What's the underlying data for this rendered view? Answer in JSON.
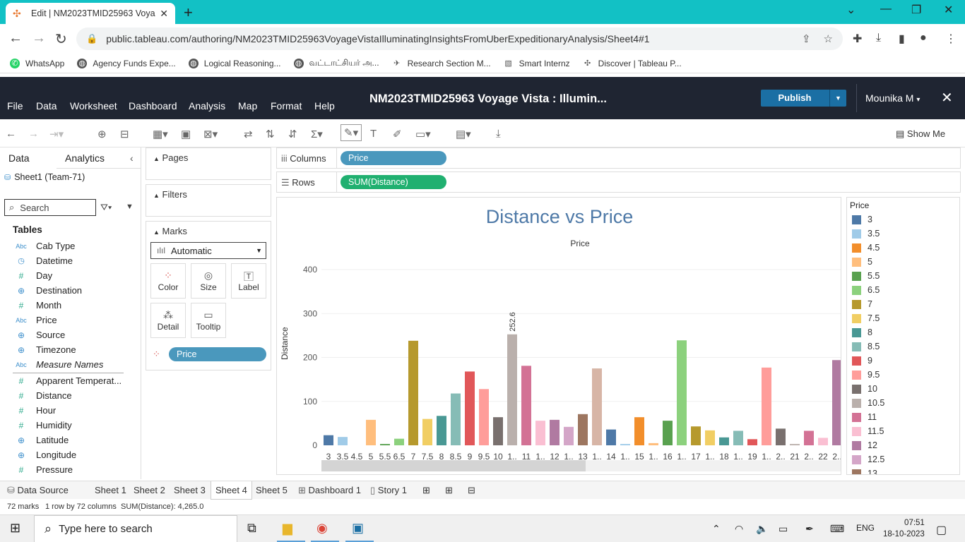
{
  "browser": {
    "tab_title": "Edit | NM2023TMID25963 Voyag",
    "url": "public.tableau.com/authoring/NM2023TMID25963VoyageVistaIlluminatingInsightsFromUberExpeditionaryAnalysis/Sheet4#1",
    "bookmarks": [
      "WhatsApp",
      "Agency Funds Expe...",
      "Logical Reasoning...",
      "வட்டாட்சியர் அ...",
      "Research Section M...",
      "Smart Internz",
      "Discover | Tableau P..."
    ]
  },
  "header": {
    "menus": [
      "File",
      "Data",
      "Worksheet",
      "Dashboard",
      "Analysis",
      "Map",
      "Format",
      "Help"
    ],
    "workbook_title": "NM2023TMID25963 Voyage Vista : Illumin...",
    "publish": "Publish",
    "user": "Mounika M"
  },
  "toolbar": {
    "show_me": "Show Me"
  },
  "data_pane": {
    "tab_data": "Data",
    "tab_analytics": "Analytics",
    "source": "Sheet1 (Team-71)",
    "search_placeholder": "Search",
    "tables_header": "Tables",
    "fields": [
      {
        "name": "Cab Type",
        "type": "abc"
      },
      {
        "name": "Datetime",
        "type": "date"
      },
      {
        "name": "Day",
        "type": "num"
      },
      {
        "name": "Destination",
        "type": "geo"
      },
      {
        "name": "Month",
        "type": "num"
      },
      {
        "name": "Price",
        "type": "abc"
      },
      {
        "name": "Source",
        "type": "geo"
      },
      {
        "name": "Timezone",
        "type": "geo"
      },
      {
        "name": "Measure Names",
        "type": "abc"
      }
    ],
    "measures": [
      {
        "name": "Apparent Temperat...",
        "type": "num"
      },
      {
        "name": "Distance",
        "type": "num"
      },
      {
        "name": "Hour",
        "type": "num"
      },
      {
        "name": "Humidity",
        "type": "num"
      },
      {
        "name": "Latitude",
        "type": "geo"
      },
      {
        "name": "Longitude",
        "type": "geo"
      },
      {
        "name": "Pressure",
        "type": "num"
      }
    ]
  },
  "cards": {
    "pages": "Pages",
    "filters": "Filters",
    "marks": "Marks",
    "mark_type": "Automatic",
    "color": "Color",
    "size": "Size",
    "label": "Label",
    "detail": "Detail",
    "tooltip": "Tooltip",
    "color_pill": "Price"
  },
  "shelves": {
    "columns_label": "Columns",
    "columns_pill": "Price",
    "rows_label": "Rows",
    "rows_pill": "SUM(Distance)"
  },
  "legend": {
    "title": "Price",
    "items": [
      {
        "label": "3",
        "color": "#4e79a7"
      },
      {
        "label": "3.5",
        "color": "#a0cbe8"
      },
      {
        "label": "4.5",
        "color": "#f28e2b"
      },
      {
        "label": "5",
        "color": "#ffbe7d"
      },
      {
        "label": "5.5",
        "color": "#59a14f"
      },
      {
        "label": "6.5",
        "color": "#8cd17d"
      },
      {
        "label": "7",
        "color": "#b6992d"
      },
      {
        "label": "7.5",
        "color": "#f1ce63"
      },
      {
        "label": "8",
        "color": "#499894"
      },
      {
        "label": "8.5",
        "color": "#86bcb6"
      },
      {
        "label": "9",
        "color": "#e15759"
      },
      {
        "label": "9.5",
        "color": "#ff9d9a"
      },
      {
        "label": "10",
        "color": "#79706e"
      },
      {
        "label": "10.5",
        "color": "#bab0ac"
      },
      {
        "label": "11",
        "color": "#d37295"
      },
      {
        "label": "11.5",
        "color": "#fabfd2"
      },
      {
        "label": "12",
        "color": "#b07aa1"
      },
      {
        "label": "12.5",
        "color": "#d4a6c8"
      },
      {
        "label": "13",
        "color": "#9d7660"
      }
    ]
  },
  "chart_data": {
    "type": "bar",
    "title": "Distance vs Price",
    "column_header": "Price",
    "ylabel": "Distance",
    "ylim": [
      0,
      400
    ],
    "yticks": [
      0,
      100,
      200,
      300,
      400
    ],
    "categories": [
      "3",
      "3.5",
      "4.5",
      "5",
      "5.5",
      "6.5",
      "7",
      "7.5",
      "8",
      "8.5",
      "9",
      "9.5",
      "10",
      "1..",
      "11",
      "1..",
      "12",
      "1..",
      "13",
      "1..",
      "14",
      "1..",
      "15",
      "1..",
      "16",
      "1..",
      "17",
      "1..",
      "18",
      "1..",
      "19",
      "1..",
      "2..",
      "21",
      "2..",
      "22",
      "2.."
    ],
    "values": [
      23,
      19,
      0,
      58,
      3,
      15,
      238,
      60,
      67,
      118,
      168,
      128,
      64,
      252.6,
      181,
      56,
      58,
      42,
      71,
      175,
      36,
      3,
      64,
      5,
      56,
      239,
      43,
      34,
      18,
      33,
      14,
      177,
      38,
      3,
      33,
      17,
      194
    ],
    "colors": [
      "#4e79a7",
      "#a0cbe8",
      "#f28e2b",
      "#ffbe7d",
      "#59a14f",
      "#8cd17d",
      "#b6992d",
      "#f1ce63",
      "#499894",
      "#86bcb6",
      "#e15759",
      "#ff9d9a",
      "#79706e",
      "#bab0ac",
      "#d37295",
      "#fabfd2",
      "#b07aa1",
      "#d4a6c8",
      "#9d7660",
      "#d7b5a6",
      "#4e79a7",
      "#a0cbe8",
      "#f28e2b",
      "#ffbe7d",
      "#59a14f",
      "#8cd17d",
      "#b6992d",
      "#f1ce63",
      "#499894",
      "#86bcb6",
      "#e15759",
      "#ff9d9a",
      "#79706e",
      "#bab0ac",
      "#d37295",
      "#fabfd2",
      "#b07aa1"
    ],
    "data_labels": [
      {
        "category_index": 13,
        "text": "252.6"
      }
    ],
    "grid": true,
    "legend": "right"
  },
  "sheet_tabs": {
    "data_source": "Data Source",
    "sheets": [
      "Sheet 1",
      "Sheet 2",
      "Sheet 3",
      "Sheet 4",
      "Sheet 5"
    ],
    "active": "Sheet 4",
    "dashboard": "Dashboard 1",
    "story": "Story 1"
  },
  "status": {
    "marks": "72 marks",
    "rows_cols": "1 row by 72 columns",
    "sum": "SUM(Distance): 4,265.0"
  },
  "taskbar": {
    "search_placeholder": "Type here to search",
    "lang": "ENG",
    "time": "07:51",
    "date": "18-10-2023"
  }
}
